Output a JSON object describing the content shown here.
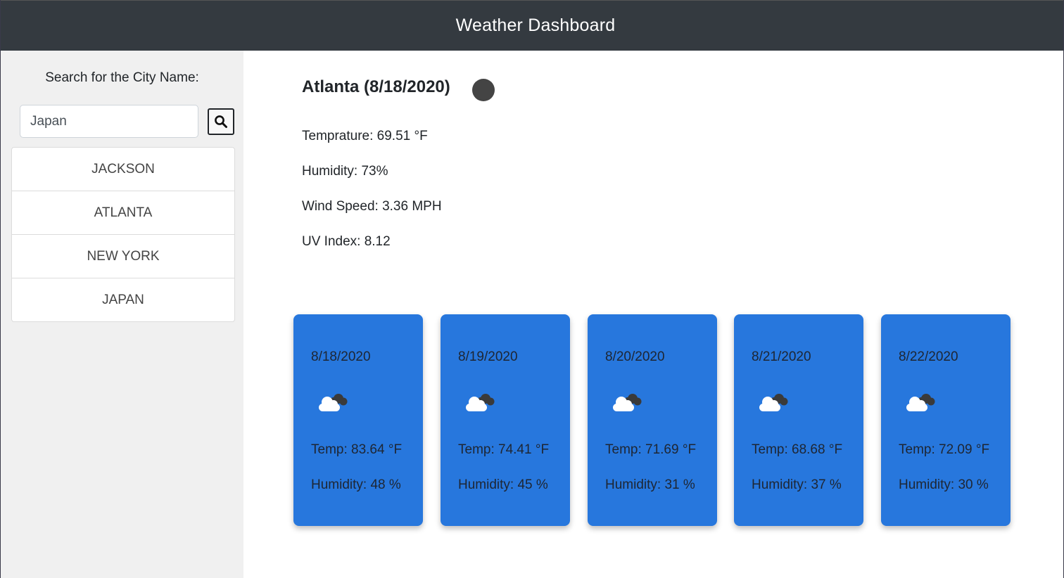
{
  "header": {
    "title": "Weather Dashboard"
  },
  "sidebar": {
    "search_label": "Search for the City Name:",
    "search_value": "Japan",
    "search_button_icon": "search-icon",
    "cities": [
      "JACKSON",
      "ATLANTA",
      "NEW YORK",
      "JAPAN"
    ]
  },
  "current": {
    "title": "Atlanta (8/18/2020)",
    "icon": "weather-icon",
    "temperature": "Temprature: 69.51 °F",
    "humidity": "Humidity: 73%",
    "wind_speed": "Wind Speed: 3.36 MPH",
    "uv_index": "UV Index: 8.12"
  },
  "forecast": [
    {
      "date": "8/18/2020",
      "icon": "cloudy-icon",
      "temp": "Temp: 83.64 °F",
      "humidity": "Humidity: 48 %"
    },
    {
      "date": "8/19/2020",
      "icon": "cloudy-icon",
      "temp": "Temp: 74.41 °F",
      "humidity": "Humidity: 45 %"
    },
    {
      "date": "8/20/2020",
      "icon": "cloudy-icon",
      "temp": "Temp: 71.69 °F",
      "humidity": "Humidity: 31 %"
    },
    {
      "date": "8/21/2020",
      "icon": "cloudy-icon",
      "temp": "Temp: 68.68 °F",
      "humidity": "Humidity: 37 %"
    },
    {
      "date": "8/22/2020",
      "icon": "cloudy-icon",
      "temp": "Temp: 72.09 °F",
      "humidity": "Humidity: 30 %"
    }
  ],
  "colors": {
    "navbar": "#343a40",
    "sidebar": "#f0f0f0",
    "card": "#2777dd"
  }
}
